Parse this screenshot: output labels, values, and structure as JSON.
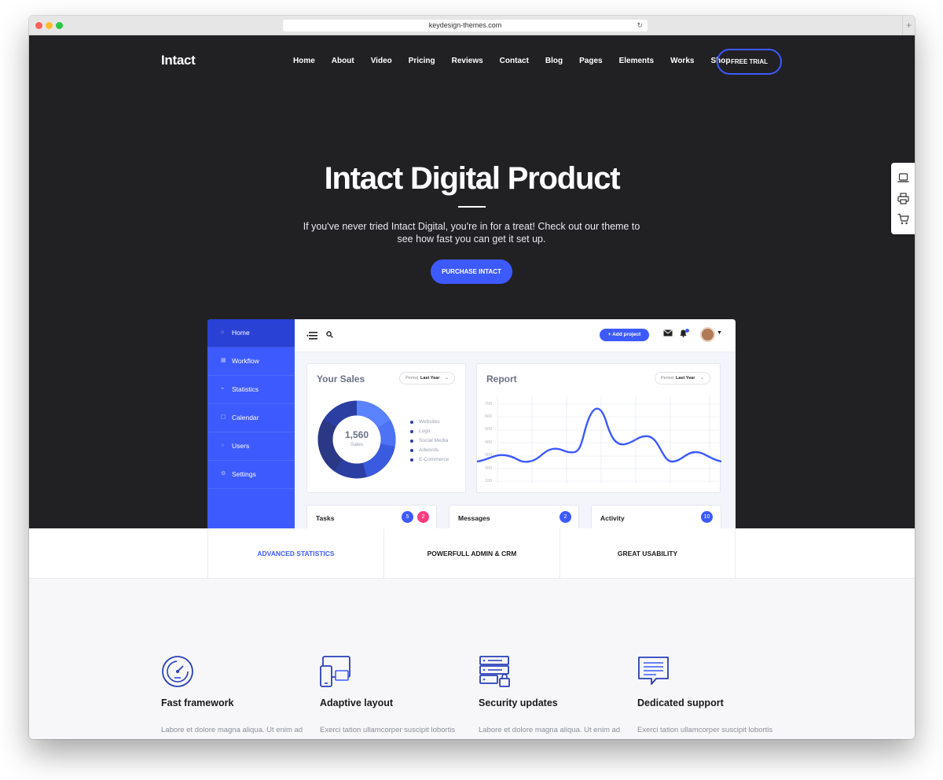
{
  "browser": {
    "url": "keydesign-themes.com"
  },
  "site": {
    "logo": "Intact",
    "nav": [
      "Home",
      "About",
      "Video",
      "Pricing",
      "Reviews",
      "Contact",
      "Blog",
      "Pages",
      "Elements",
      "Works",
      "Shop"
    ],
    "cta": "FREE TRIAL"
  },
  "hero": {
    "title": "Intact Digital Product",
    "subtitle": "If you've never tried Intact Digital, you're in for a treat! Check out our theme to see how fast you can get it set up.",
    "button": "PURCHASE INTACT"
  },
  "dashboard": {
    "sidebar": [
      "Home",
      "Workflow",
      "Statistics",
      "Calendar",
      "Users",
      "Settings"
    ],
    "add_project": "+ Add project",
    "sales": {
      "title": "Your Sales",
      "period_label": "Period",
      "period_value": "Last Year",
      "total": "1,560",
      "total_label": "Sales",
      "legend": [
        "Websites",
        "Logo",
        "Social Media",
        "Adwords",
        "E-Commerce"
      ]
    },
    "report": {
      "title": "Report",
      "period_label": "Period",
      "period_value": "Last Year",
      "yticks": [
        "700",
        "600",
        "500",
        "400",
        "300",
        "200",
        "100"
      ]
    },
    "mini_cards": [
      {
        "label": "Tasks",
        "badge1": "5",
        "badge2": "2"
      },
      {
        "label": "Messages",
        "badge1": "2"
      },
      {
        "label": "Activity",
        "badge1": "10"
      }
    ]
  },
  "tabs": [
    "ADVANCED STATISTICS",
    "POWERFULL ADMIN & CRM",
    "GREAT USABILITY"
  ],
  "features": [
    {
      "title": "Fast framework",
      "text": "Labore et dolore magna aliqua. Ut enim ad",
      "icon": "speedometer-icon"
    },
    {
      "title": "Adaptive layout",
      "text": "Exerci tation ullamcorper suscipit lobortis",
      "icon": "devices-icon"
    },
    {
      "title": "Security updates",
      "text": "Labore et dolore magna aliqua. Ut enim ad",
      "icon": "server-lock-icon"
    },
    {
      "title": "Dedicated support",
      "text": "Exerci tation ullamcorper suscipit lobortis",
      "icon": "chat-icon"
    }
  ],
  "colors": {
    "accent": "#3d5afe",
    "hero_bg": "#212124",
    "badge_pink": "#ff3b7f"
  }
}
